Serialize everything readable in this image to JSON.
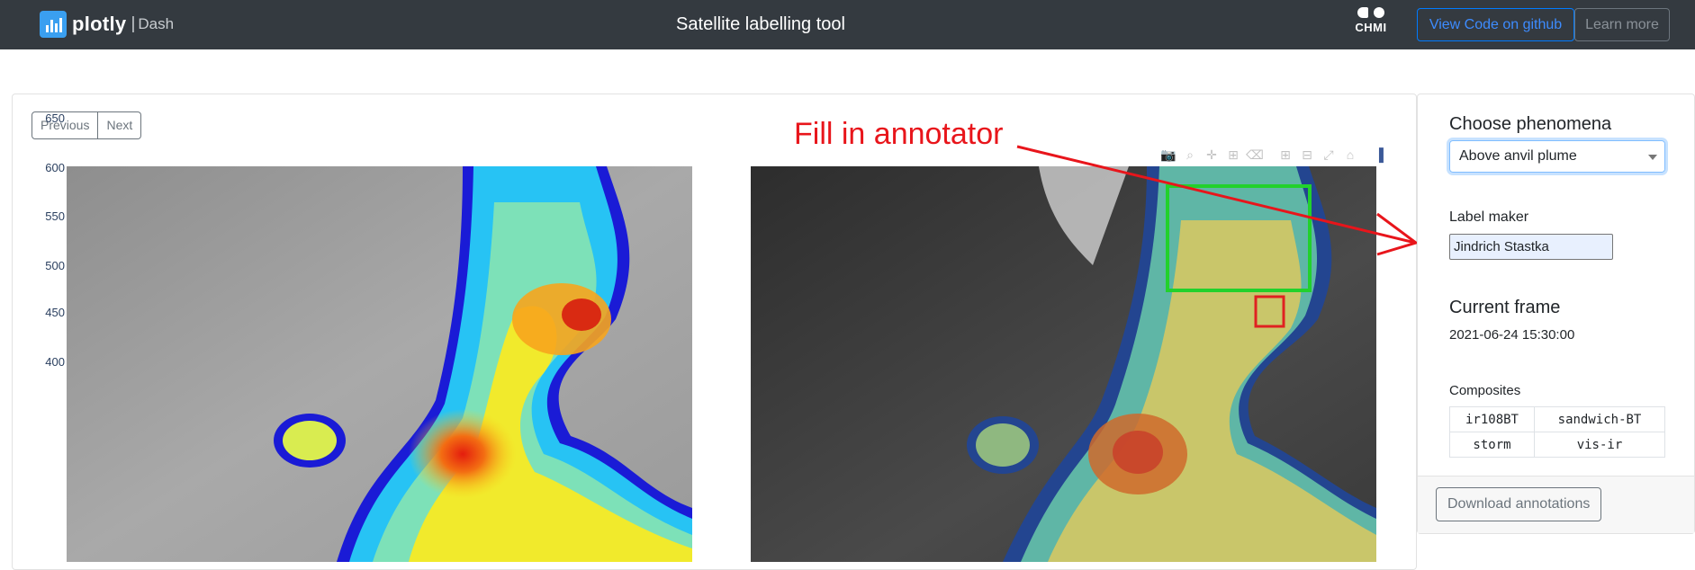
{
  "navbar": {
    "brand": "plotly",
    "brand_sep": "|",
    "brand_sub": "Dash",
    "title": "Satellite labelling tool",
    "org_logo": "CHMI",
    "github_button": "View Code on github",
    "learn_button": "Learn more"
  },
  "main": {
    "prev_button": "Previous",
    "next_button": "Next",
    "annotation_text": "Fill in annotator",
    "y_ticks": [
      "650",
      "600",
      "550",
      "500",
      "450",
      "400"
    ],
    "modebar_icons": [
      "camera-icon",
      "zoom-icon",
      "pan-icon",
      "box-select-icon",
      "erase-icon",
      "zoom-in-icon",
      "zoom-out-icon",
      "autoscale-icon",
      "home-icon",
      "plotly-logo-icon"
    ],
    "colors": {
      "annotation": "#e8151b",
      "box_green": "#22d12c",
      "box_red": "#e02121"
    }
  },
  "sidebar": {
    "phenomena_heading": "Choose phenomena",
    "phenomena_value": "Above anvil plume",
    "label_maker_heading": "Label maker",
    "label_maker_value": "Jindrich Stastka",
    "frame_heading": "Current frame",
    "frame_value": "2021-06-24 15:30:00",
    "composites_heading": "Composites",
    "composites": [
      [
        "ir108BT",
        "sandwich-BT"
      ],
      [
        "storm",
        "vis-ir"
      ]
    ],
    "download_button": "Download annotations"
  }
}
